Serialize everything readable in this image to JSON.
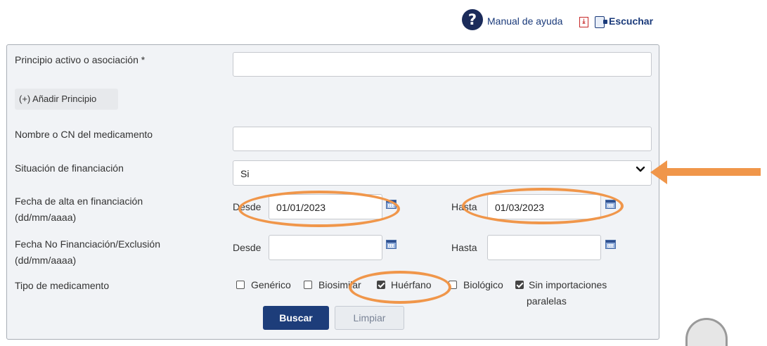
{
  "help": {
    "manual_label": "Manual de ayuda",
    "listen_label": "Escuchar"
  },
  "form": {
    "active_ingredient": {
      "label": "Principio activo o asociación *",
      "value": ""
    },
    "add_ingredient_label": "(+) Añadir Principio",
    "medicine_name": {
      "label": "Nombre o CN del medicamento",
      "value": ""
    },
    "financing_status": {
      "label": "Situación de financiación",
      "selected": "Si"
    },
    "financing_date": {
      "label_line1": "Fecha de alta en financiación",
      "label_line2": "(dd/mm/aaaa)",
      "from_label": "Desde",
      "from_value": "01/01/2023",
      "to_label": "Hasta",
      "to_value": "01/03/2023"
    },
    "exclusion_date": {
      "label_line1": "Fecha No Financiación/Exclusión",
      "label_line2": "(dd/mm/aaaa)",
      "from_label": "Desde",
      "from_value": "",
      "to_label": "Hasta",
      "to_value": ""
    },
    "medicine_type": {
      "label": "Tipo de medicamento",
      "options": [
        {
          "label": "Genérico",
          "checked": false
        },
        {
          "label": "Biosimilar",
          "checked": false
        },
        {
          "label": "Huérfano",
          "checked": true
        },
        {
          "label": "Biológico",
          "checked": false
        },
        {
          "label_line1": "Sin importaciones",
          "label_line2": "paralelas",
          "checked": true
        }
      ]
    },
    "search_button": "Buscar",
    "clear_button": "Limpiar"
  },
  "colors": {
    "primary": "#1d3d7a",
    "annotation": "#f0964a",
    "panel_bg": "#f1f3f6"
  },
  "icons": [
    "help-circle-icon",
    "pdf-icon",
    "listen-icon",
    "chevron-down-icon",
    "calendar-icon"
  ]
}
